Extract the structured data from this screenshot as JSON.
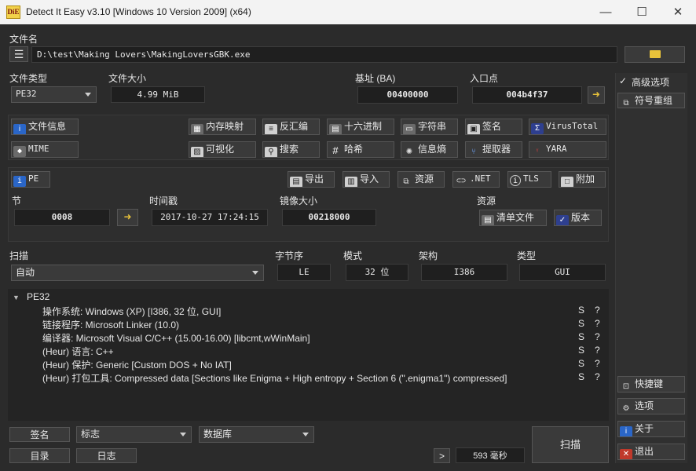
{
  "window": {
    "title": "Detect It Easy v3.10 [Windows 10 Version 2009] (x64)",
    "app_icon_text": "DiE",
    "minimize": "—",
    "maximize": "☐",
    "close": "✕"
  },
  "file": {
    "label": "文件名",
    "path": "D:\\test\\Making Lovers\\MakingLoversGBK.exe"
  },
  "info": {
    "file_type_label": "文件类型",
    "file_type_value": "PE32",
    "file_size_label": "文件大小",
    "file_size_value": "4.99 MiB",
    "base_label": "基址 (BA)",
    "base_value": "00400000",
    "entry_label": "入口点",
    "entry_value": "004b4f37"
  },
  "tools_row1": [
    "文件信息",
    "内存映射",
    "反汇编",
    "十六进制",
    "字符串",
    "签名",
    "VirusTotal"
  ],
  "tools_row2": [
    "MIME",
    "可视化",
    "搜索",
    "哈希",
    "信息熵",
    "提取器",
    "YARA"
  ],
  "pe_row": {
    "pe": "PE",
    "export": "导出",
    "import": "导入",
    "resources": "资源",
    "net": ".NET",
    "tls": "TLS",
    "overlay": "附加"
  },
  "sections": {
    "section_label": "节",
    "section_value": "0008",
    "time_label": "时间戳",
    "time_value": "2017-10-27 17:24:15",
    "image_size_label": "镜像大小",
    "image_size_value": "00218000",
    "resources_label": "资源",
    "manifest": "清单文件",
    "version": "版本"
  },
  "scan": {
    "label": "扫描",
    "mode_value": "自动",
    "endian_label": "字节序",
    "endian_value": "LE",
    "mode_label": "模式",
    "mode_bits": "32 位",
    "arch_label": "架构",
    "arch_value": "I386",
    "type_label": "类型",
    "type_value": "GUI"
  },
  "results": {
    "root": "PE32",
    "rows": [
      "操作系统: Windows (XP) [I386, 32 位, GUI]",
      "链接程序: Microsoft Linker (10.0)",
      "编译器: Microsoft Visual C/C++ (15.00-16.00) [libcmt,wWinMain]",
      "(Heur) 语言: C++",
      "(Heur) 保护: Generic [Custom DOS + No IAT]",
      "(Heur) 打包工具: Compressed data [Sections like Enigma + High entropy + Section 6 (\".enigma1\") compressed]"
    ],
    "s_label": "S",
    "q_label": "?"
  },
  "bottom": {
    "signatures": "签名",
    "flags": "标志",
    "database": "数据库",
    "directory": "目录",
    "log": "日志",
    "next": ">",
    "time": "593 毫秒",
    "scan": "扫描"
  },
  "right": {
    "advanced": "高级选项",
    "check": "✓",
    "demangle": "符号重组",
    "shortcuts": "快捷键",
    "options": "选项",
    "about": "关于",
    "exit": "退出"
  }
}
